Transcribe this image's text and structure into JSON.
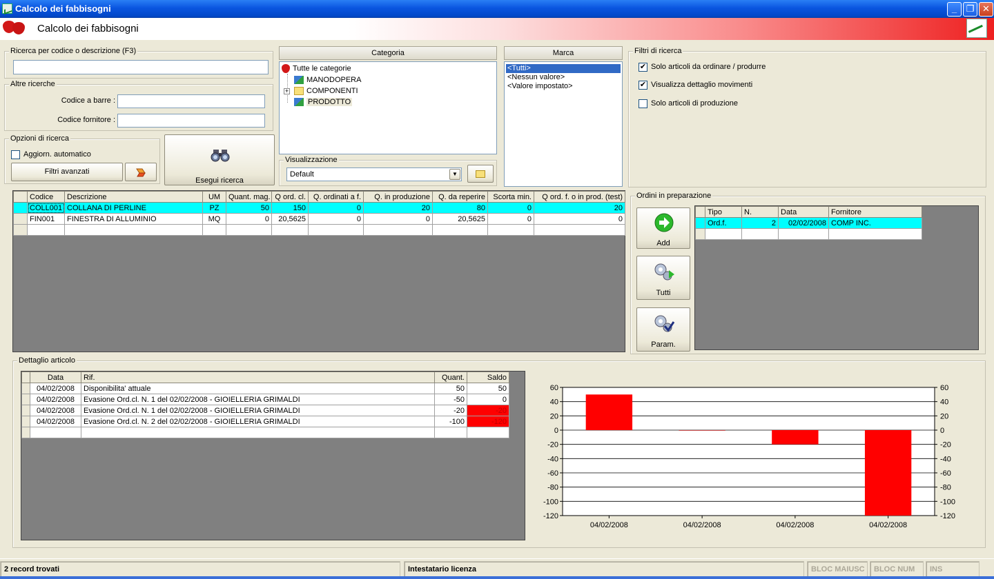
{
  "window": {
    "title": "Calcolo dei fabbisogni",
    "minimize": "_",
    "maximize": "❐",
    "close": "✕"
  },
  "header": {
    "title": "Calcolo dei fabbisogni"
  },
  "search": {
    "legend": "Ricerca per codice o descrizione (F3)",
    "value": "",
    "placeholder": ""
  },
  "other_searches": {
    "legend": "Altre ricerche",
    "barcode_label": "Codice a barre :",
    "barcode_value": "",
    "supplier_code_label": "Codice fornitore :",
    "supplier_code_value": ""
  },
  "search_options": {
    "legend": "Opzioni di ricerca",
    "auto_update_label": "Aggiorn. automatico",
    "auto_update_checked": false,
    "advanced_filters_label": "Filtri avanzati"
  },
  "run_search": {
    "label": "Esegui ricerca"
  },
  "category": {
    "title": "Categoria",
    "root": "Tutte le categorie",
    "items": [
      {
        "label": "MANODOPERA",
        "expandable": false
      },
      {
        "label": "COMPONENTI",
        "expandable": true
      },
      {
        "label": "PRODOTTO",
        "expandable": false
      }
    ],
    "view_legend": "Visualizzazione",
    "view_value": "Default"
  },
  "brand": {
    "title": "Marca",
    "items": [
      "<Tutti>",
      "<Nessun valore>",
      "<Valore impostato>"
    ],
    "selected_index": 0
  },
  "filters": {
    "legend": "Filtri di ricerca",
    "items": [
      {
        "label": "Solo articoli da ordinare / produrre",
        "checked": true
      },
      {
        "label": "Visualizza dettaglio movimenti",
        "checked": true
      },
      {
        "label": "Solo articoli di produzione",
        "checked": false
      }
    ]
  },
  "main_grid": {
    "columns": [
      "Codice",
      "Descrizione",
      "UM",
      "Quant. mag.",
      "Q ord. cl.",
      "Q. ordinati a f.",
      "Q. in produzione",
      "Q. da reperire",
      "Scorta min.",
      "Q ord. f. o in prod. (test)"
    ],
    "rows": [
      [
        "COLL001",
        "COLLANA DI PERLINE",
        "PZ",
        "50",
        "150",
        "0",
        "20",
        "80",
        "0",
        "20"
      ],
      [
        "FIN001",
        "FINESTRA DI ALLUMINIO",
        "MQ",
        "0",
        "20,5625",
        "0",
        "0",
        "20,5625",
        "0",
        "0"
      ]
    ],
    "selected_row": 0
  },
  "orders_prep": {
    "legend": "Ordini in preparazione",
    "add_label": "Add",
    "all_label": "Tutti",
    "param_label": "Param.",
    "columns": [
      "Tipo",
      "N.",
      "Data",
      "Fornitore"
    ],
    "rows": [
      [
        "Ord.f.",
        "2",
        "02/02/2008",
        "COMP INC."
      ]
    ]
  },
  "detail": {
    "legend": "Dettaglio articolo",
    "columns": [
      "Data",
      "Rif.",
      "Quant.",
      "Saldo"
    ],
    "rows": [
      [
        "04/02/2008",
        "Disponibilita' attuale",
        "50",
        "50"
      ],
      [
        "04/02/2008",
        "Evasione Ord.cl. N. 1 del 02/02/2008 - GIOIELLERIA GRIMALDI",
        "-50",
        "0"
      ],
      [
        "04/02/2008",
        "Evasione Ord.cl. N. 1 del 02/02/2008 - GIOIELLERIA GRIMALDI",
        "-20",
        "-20"
      ],
      [
        "04/02/2008",
        "Evasione Ord.cl. N. 2 del 02/02/2008 - GIOIELLERIA GRIMALDI",
        "-100",
        "-120"
      ]
    ],
    "negative_color": "#ff0000"
  },
  "chart_data": {
    "type": "bar",
    "categories": [
      "04/02/2008",
      "04/02/2008",
      "04/02/2008",
      "04/02/2008"
    ],
    "values": [
      50,
      0,
      -20,
      -120
    ],
    "ylim": [
      -120,
      60
    ],
    "yticks": [
      60,
      40,
      20,
      0,
      -20,
      -40,
      -60,
      -80,
      -100,
      -120
    ],
    "bar_color": "#ff0000",
    "grid": true,
    "right_axis": true
  },
  "status": {
    "records": "2 record trovati",
    "license": "Intestatario licenza",
    "caps": "BLOC MAIUSC",
    "num": "BLOC NUM",
    "ins": "INS"
  }
}
